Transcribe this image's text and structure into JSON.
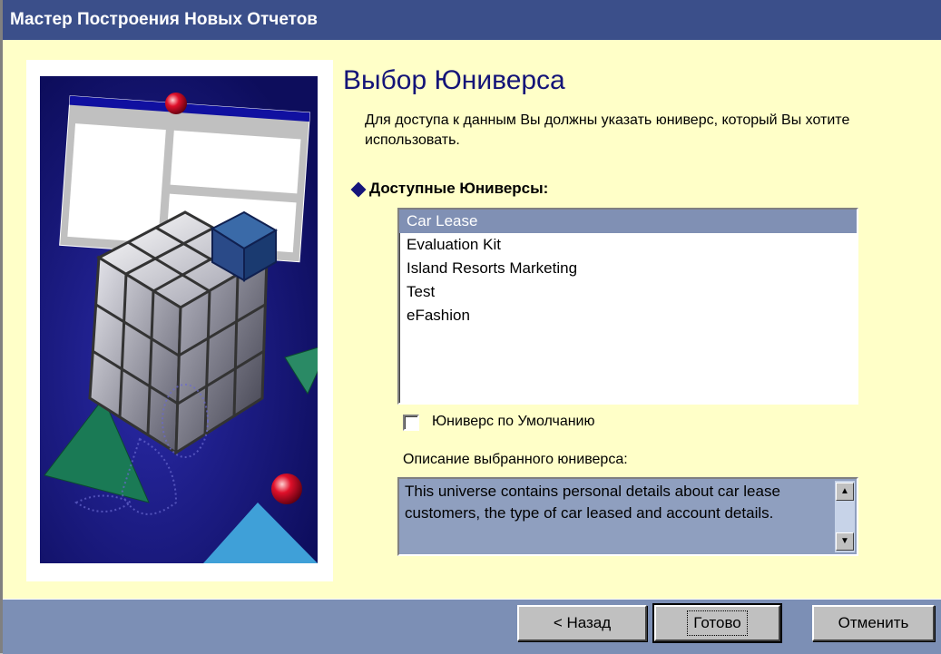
{
  "window": {
    "title": "Мастер Построения Новых Отчетов"
  },
  "page": {
    "heading": "Выбор Юниверса",
    "intro": "Для доступа к данным Вы должны указать юниверс, который Вы хотите использовать."
  },
  "universes": {
    "label": "Доступные Юниверсы:",
    "items": [
      "Car Lease",
      "Evaluation Kit",
      "Island Resorts Marketing",
      "Test",
      "eFashion"
    ],
    "selected": "Car Lease"
  },
  "default_checkbox": {
    "label": "Юниверс по Умолчанию",
    "checked": false
  },
  "description": {
    "label": "Описание выбранного юниверса:",
    "text": "This universe contains personal details about car lease customers, the type of car leased and account details."
  },
  "buttons": {
    "back": "< Назад",
    "finish": "Готово",
    "cancel": "Отменить"
  },
  "colors": {
    "title_bar": "#3b4f8a",
    "panel": "#ffffc8",
    "selection": "#8090b4",
    "heading": "#141478"
  }
}
